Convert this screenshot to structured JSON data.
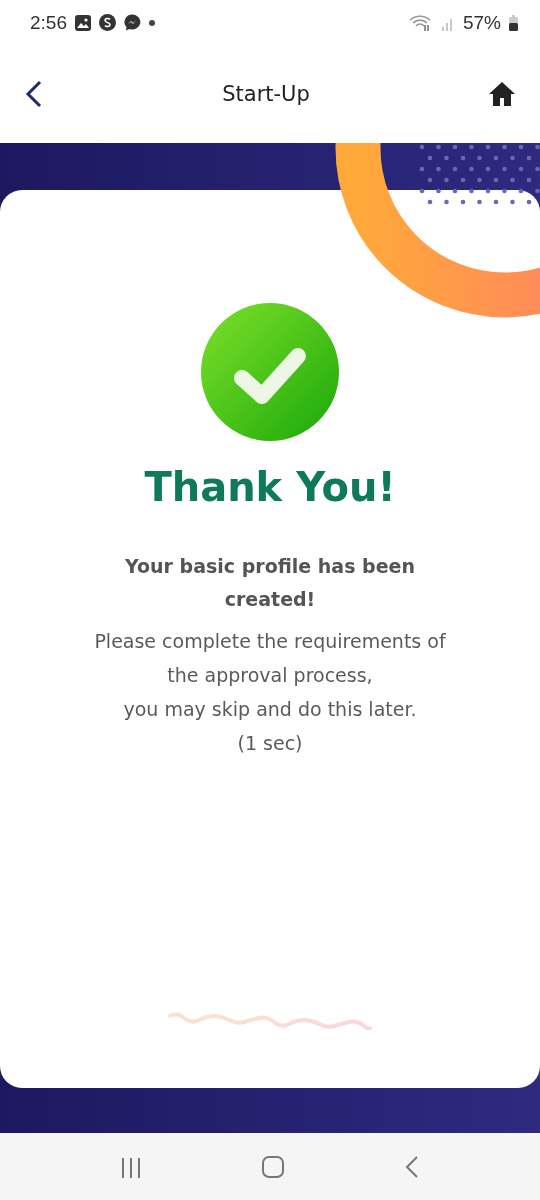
{
  "status_bar": {
    "time": "2:56",
    "battery": "57%"
  },
  "header": {
    "title": "Start-Up"
  },
  "result": {
    "title": "Thank You!",
    "subtitle": "Your basic profile has been created!",
    "message_lines": [
      "Please complete the requirements of the approval process,",
      "you may skip and do this later.",
      "(1 sec)"
    ]
  }
}
